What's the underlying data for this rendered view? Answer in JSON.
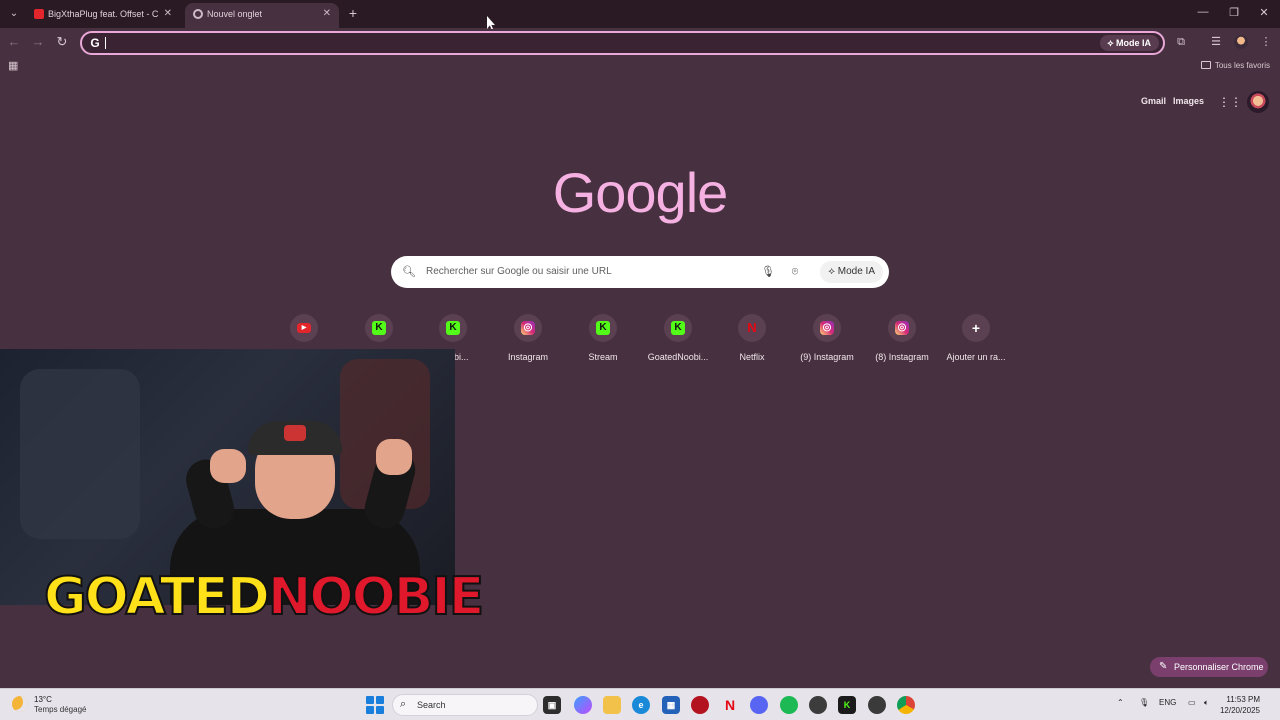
{
  "browser": {
    "tabs": [
      {
        "title": "BigXthaPlug feat. Offset - Clima",
        "favicon": "youtube-icon",
        "active": false
      },
      {
        "title": "Nouvel onglet",
        "favicon": "chrome-icon",
        "active": true
      }
    ],
    "omnibox": {
      "value": "",
      "mode_label": "Mode IA"
    },
    "bookmarks": {
      "all_favorites": "Tous les favoris"
    }
  },
  "ntp": {
    "top_links": {
      "gmail": "Gmail",
      "images": "Images"
    },
    "logo": "Google",
    "search": {
      "placeholder": "Rechercher sur Google ou saisir une URL",
      "mode_label": "Mode IA"
    },
    "shortcuts": [
      {
        "label": "",
        "icon": "youtube-icon",
        "color": "#e3262b"
      },
      {
        "label": "",
        "icon": "kick-icon",
        "color": "#53fc18"
      },
      {
        "label": "Noobi...",
        "icon": "kick-icon",
        "color": "#53fc18"
      },
      {
        "label": "Instagram",
        "icon": "instagram-icon",
        "color": "#d6249f"
      },
      {
        "label": "Stream",
        "icon": "kick-icon",
        "color": "#53fc18"
      },
      {
        "label": "GoatedNoobi...",
        "icon": "kick-icon",
        "color": "#53fc18"
      },
      {
        "label": "Netflix",
        "icon": "netflix-icon",
        "color": "#e50914"
      },
      {
        "label": "(9) Instagram",
        "icon": "instagram-icon",
        "color": "#d6249f"
      },
      {
        "label": "(8) Instagram",
        "icon": "instagram-icon",
        "color": "#d6249f"
      },
      {
        "label": "Ajouter un ra...",
        "icon": "plus-icon",
        "color": "#5a4050"
      }
    ],
    "customize_label": "Personnaliser Chrome"
  },
  "webcam": {
    "banner_part1": "GOATED",
    "banner_part2": "NOOBIE"
  },
  "taskbar": {
    "weather": {
      "temp": "13°C",
      "desc": "Temps dégagé"
    },
    "search_label": "Search",
    "language": "ENG",
    "time": "11:53 PM",
    "date": "12/20/2025"
  },
  "colors": {
    "background": "#47303f",
    "accent": "#f5b1e2",
    "omnibox_border": "#e9a8d8"
  }
}
